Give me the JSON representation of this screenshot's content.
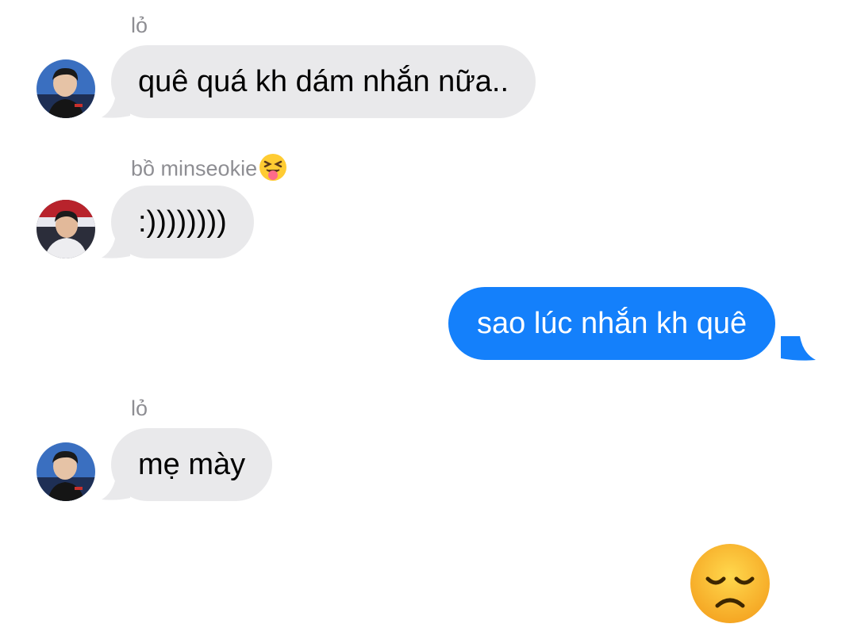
{
  "messages": [
    {
      "sender": "lỏ",
      "text": "quê quá kh dám nhắn nữa..",
      "direction": "incoming"
    },
    {
      "sender": "bồ minseokie",
      "sender_emoji": "squinting-face-with-tongue-icon",
      "text": ":))))))))",
      "direction": "incoming"
    },
    {
      "text": "sao lúc nhắn kh quê",
      "direction": "outgoing"
    },
    {
      "sender": "lỏ",
      "text": "mẹ mày",
      "direction": "incoming"
    }
  ],
  "reaction": {
    "icon": "disappointed-face-icon"
  },
  "colors": {
    "incoming_bubble": "#e9e9eb",
    "outgoing_bubble": "#1480fb",
    "sender_label": "#8e8e93"
  }
}
